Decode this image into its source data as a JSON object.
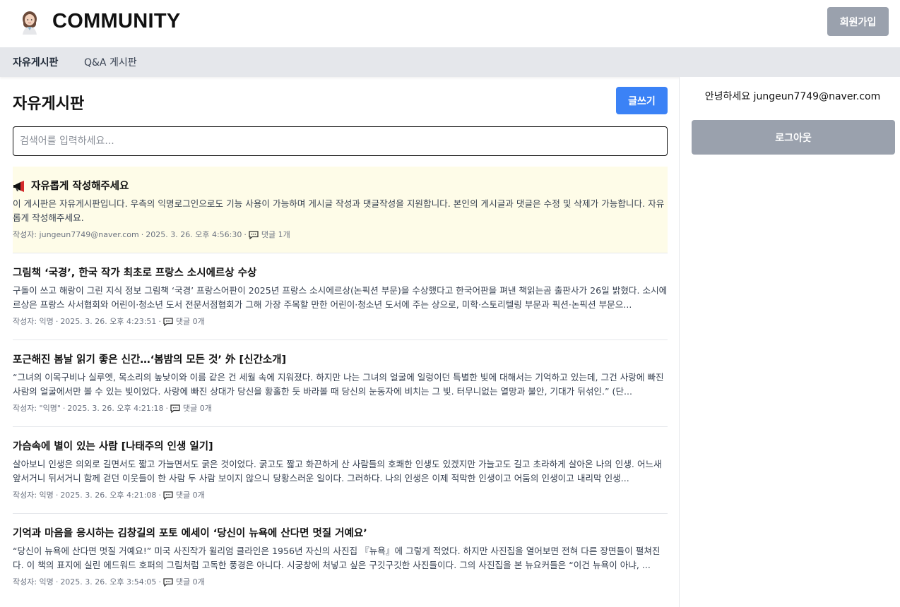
{
  "header": {
    "site_title": "COMMUNITY",
    "signup_label": "회원가입"
  },
  "nav": {
    "tabs": [
      {
        "label": "자유게시판",
        "active": true
      },
      {
        "label": "Q&A 게시판",
        "active": false
      }
    ]
  },
  "main": {
    "board_title": "자유게시판",
    "write_label": "글쓰기",
    "search_placeholder": "검색어를 입력하세요...",
    "posts": [
      {
        "notice": true,
        "icon": "megaphone-icon",
        "title": "자유롭게 작성해주세요",
        "body": "이 게시판은 자유게시판입니다. 우측의 익명로그인으로도 기능 사용이 가능하며 게시글 작성과 댓글작성을 지원합니다. 본인의 게시글과 댓글은 수정 및 삭제가 가능합니다. 자유롭게 작성해주세요.",
        "author": "작성자: jungeun7749@naver.com",
        "date": "2025. 3. 26. 오후 4:56:30",
        "comments": "댓글 1개"
      },
      {
        "notice": false,
        "title": "그림책 ‘국경’, 한국 작가 최초로 프랑스 소시에르상 수상",
        "body": "구돌이 쓰고 해랑이 그린 지식 정보 그림책 ‘국경’ 프랑스어판이 2025년 프랑스 소시에르상(논픽션 부문)을 수상했다고 한국어판을 펴낸 책읽는곰 출판사가 26일 밝혔다. 소시에르상은 프랑스 사서협회와 어린이·청소년 도서 전문서점협회가 그해 가장 주목할 만한 어린이·청소년 도서에 주는 상으로, 미학·스토리텔링 부문과 픽션·논픽션 부문으...",
        "author": "작성자: 익명",
        "date": "2025. 3. 26. 오후 4:23:51",
        "comments": "댓글 0개"
      },
      {
        "notice": false,
        "title": "포근해진 봄날 읽기 좋은 신간…‘봄밤의 모든 것’ 外 [신간소개]",
        "body": "“그녀의 이목구비나 실루엣, 목소리의 높낮이와 이름 같은 건 세월 속에 지워졌다. 하지만 나는 그녀의 얼굴에 일렁이던 특별한 빛에 대해서는 기억하고 있는데, 그건 사랑에 빠진 사람의 얼굴에서만 볼 수 있는 빛이었다. 사랑에 빠진 상대가 당신을 황홀한 듯 바라볼 때 당신의 눈동자에 비치는 그 빛. 터무니없는 열망과 불안, 기대가 뒤섞인.” (단...",
        "author": "작성자: \"익명\"",
        "date": "2025. 3. 26. 오후 4:21:18",
        "comments": "댓글 0개"
      },
      {
        "notice": false,
        "title": "가슴속에 별이 있는 사람 [나태주의 인생 일기]",
        "body": "살아보니 인생은 의외로 길면서도 짧고 가늘면서도 굵은 것이었다. 굵고도 짧고 화끈하게 산 사람들의 호쾌한 인생도 있겠지만 가늘고도 길고 초라하게 살아온 나의 인생. 어느새 앞서거니 뒤서거니 함께 걷던 이웃들이 한 사람 두 사람 보이지 않으니 당황스러운 일이다. 그러하다. 나의 인생은 이제 적막한 인생이고 어둠의 인생이고 내리막 인생...",
        "author": "작성자: 익명",
        "date": "2025. 3. 26. 오후 4:21:08",
        "comments": "댓글 0개"
      },
      {
        "notice": false,
        "title": "기억과 마음을 응시하는 김창길의 포토 에세이 ‘당신이 뉴욕에 산다면 멋질 거예요’",
        "body": "“당신이 뉴욕에 산다면 멋질 거예요!” 미국 사진작가 윌리엄 클라인은 1956년 자신의 사진집 『뉴욕』에 그렇게 적었다. 하지만 사진집을 열어보면 전혀 다른 장면들이 펼쳐진다. 이 책의 표지에 실린 에드워드 호퍼의 그림처럼 고독한 풍경은 아니다. 시궁창에 처넣고 싶은 구깃구깃한 사진들이다. 그의 사진집을 본 뉴요커들은 “이건 뉴욕이 아냐, ...",
        "author": "작성자: 익명",
        "date": "2025. 3. 26. 오후 3:54:05",
        "comments": "댓글 0개"
      }
    ]
  },
  "sidebar": {
    "greeting": "안녕하세요 jungeun7749@naver.com",
    "logout_label": "로그아웃"
  },
  "colors": {
    "primary": "#3b82f6",
    "muted_button": "#9aa1ad",
    "nav_bg": "#e5e7eb",
    "notice_bg": "#fefce8"
  }
}
